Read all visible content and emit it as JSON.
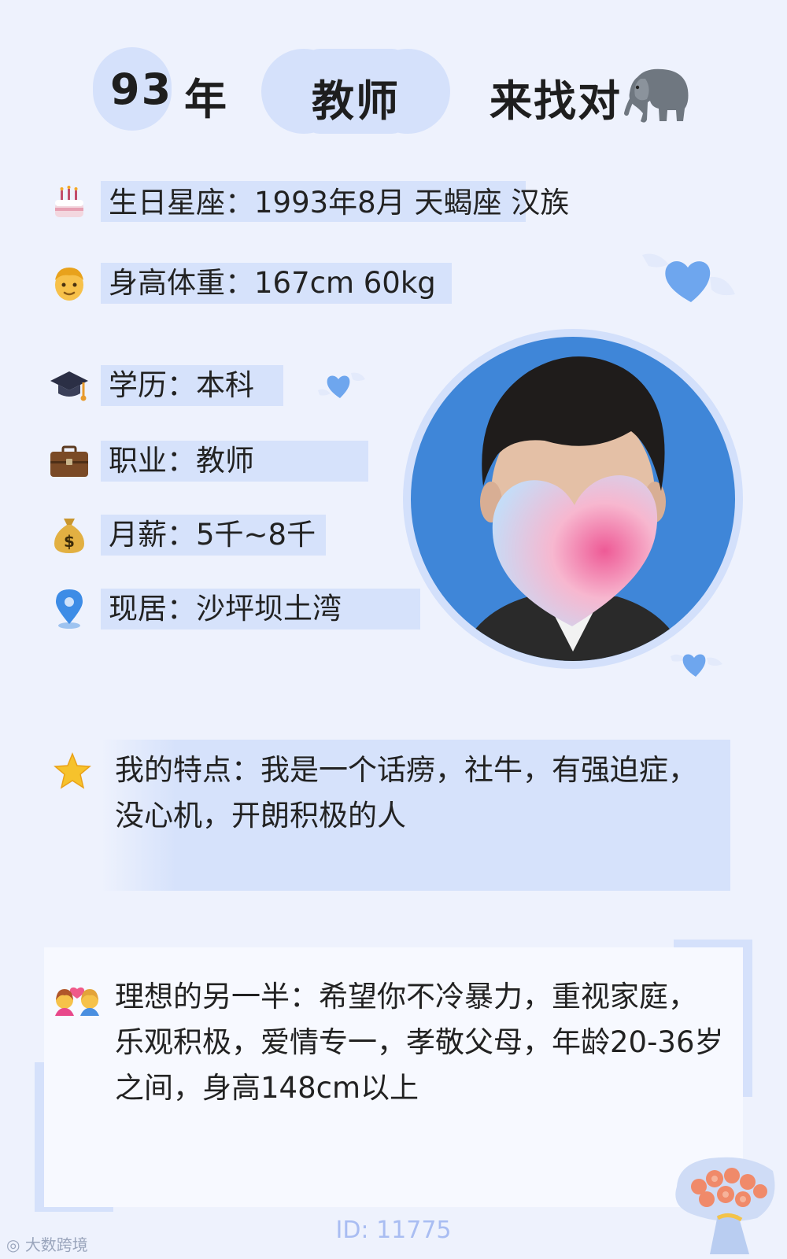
{
  "header": {
    "age": "93",
    "age_suffix": "年",
    "job": "教师",
    "tagline": "来找对"
  },
  "info": {
    "birthday": "生日星座：1993年8月 天蝎座 汉族",
    "body": "身高体重：167cm 60kg",
    "education": "学历：本科",
    "job": "职业：教师",
    "salary": "月薪：5千~8千",
    "residence": "现居：沙坪坝土湾"
  },
  "traits": {
    "line1": "我的特点：我是一个话痨，社牛，有强迫症，",
    "line2": "没心机，开朗积极的人"
  },
  "ideal": {
    "line1": "理想的另一半：希望你不冷暴力，重视家庭，",
    "line2": "乐观积极，爱情专一，孝敬父母，年龄20-36岁",
    "line3": "之间，身高148cm以上"
  },
  "footer": {
    "id_label": "ID: 11775"
  },
  "watermark": {
    "text": "大数跨境"
  },
  "icons": {
    "birthday": "cake-icon",
    "body": "man-face-icon",
    "education": "graduation-cap-icon",
    "job": "briefcase-icon",
    "salary": "money-bag-icon",
    "residence": "location-pin-icon",
    "traits": "star-icon",
    "ideal": "couple-heart-icon"
  },
  "colors": {
    "background": "#eef2fd",
    "accent": "#d5e1fb",
    "avatar_bg": "#3f86d8",
    "id_text": "#a9bdf2"
  }
}
